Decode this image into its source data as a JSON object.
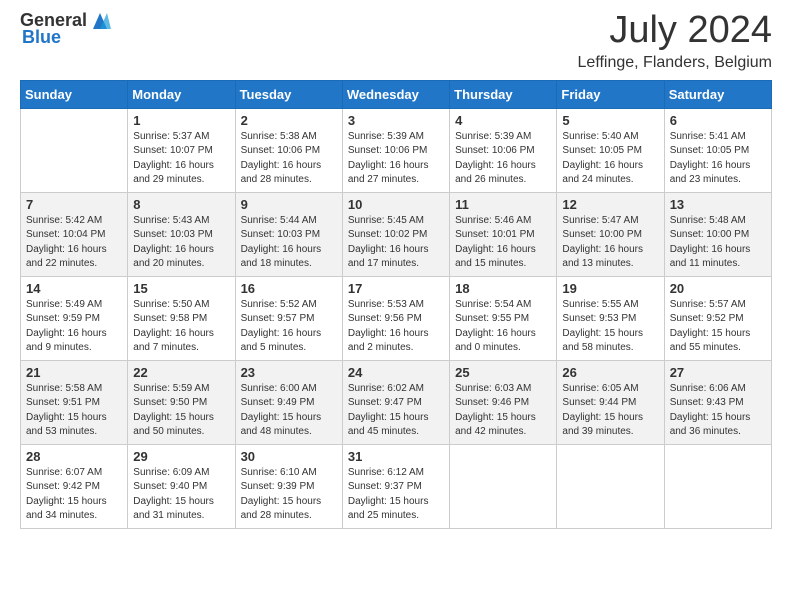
{
  "logo": {
    "general": "General",
    "blue": "Blue",
    "icon_color": "#2176c7"
  },
  "header": {
    "month": "July 2024",
    "location": "Leffinge, Flanders, Belgium"
  },
  "days_header": [
    "Sunday",
    "Monday",
    "Tuesday",
    "Wednesday",
    "Thursday",
    "Friday",
    "Saturday"
  ],
  "weeks": [
    [
      {
        "day": "",
        "info": ""
      },
      {
        "day": "1",
        "info": "Sunrise: 5:37 AM\nSunset: 10:07 PM\nDaylight: 16 hours\nand 29 minutes."
      },
      {
        "day": "2",
        "info": "Sunrise: 5:38 AM\nSunset: 10:06 PM\nDaylight: 16 hours\nand 28 minutes."
      },
      {
        "day": "3",
        "info": "Sunrise: 5:39 AM\nSunset: 10:06 PM\nDaylight: 16 hours\nand 27 minutes."
      },
      {
        "day": "4",
        "info": "Sunrise: 5:39 AM\nSunset: 10:06 PM\nDaylight: 16 hours\nand 26 minutes."
      },
      {
        "day": "5",
        "info": "Sunrise: 5:40 AM\nSunset: 10:05 PM\nDaylight: 16 hours\nand 24 minutes."
      },
      {
        "day": "6",
        "info": "Sunrise: 5:41 AM\nSunset: 10:05 PM\nDaylight: 16 hours\nand 23 minutes."
      }
    ],
    [
      {
        "day": "7",
        "info": "Sunrise: 5:42 AM\nSunset: 10:04 PM\nDaylight: 16 hours\nand 22 minutes."
      },
      {
        "day": "8",
        "info": "Sunrise: 5:43 AM\nSunset: 10:03 PM\nDaylight: 16 hours\nand 20 minutes."
      },
      {
        "day": "9",
        "info": "Sunrise: 5:44 AM\nSunset: 10:03 PM\nDaylight: 16 hours\nand 18 minutes."
      },
      {
        "day": "10",
        "info": "Sunrise: 5:45 AM\nSunset: 10:02 PM\nDaylight: 16 hours\nand 17 minutes."
      },
      {
        "day": "11",
        "info": "Sunrise: 5:46 AM\nSunset: 10:01 PM\nDaylight: 16 hours\nand 15 minutes."
      },
      {
        "day": "12",
        "info": "Sunrise: 5:47 AM\nSunset: 10:00 PM\nDaylight: 16 hours\nand 13 minutes."
      },
      {
        "day": "13",
        "info": "Sunrise: 5:48 AM\nSunset: 10:00 PM\nDaylight: 16 hours\nand 11 minutes."
      }
    ],
    [
      {
        "day": "14",
        "info": "Sunrise: 5:49 AM\nSunset: 9:59 PM\nDaylight: 16 hours\nand 9 minutes."
      },
      {
        "day": "15",
        "info": "Sunrise: 5:50 AM\nSunset: 9:58 PM\nDaylight: 16 hours\nand 7 minutes."
      },
      {
        "day": "16",
        "info": "Sunrise: 5:52 AM\nSunset: 9:57 PM\nDaylight: 16 hours\nand 5 minutes."
      },
      {
        "day": "17",
        "info": "Sunrise: 5:53 AM\nSunset: 9:56 PM\nDaylight: 16 hours\nand 2 minutes."
      },
      {
        "day": "18",
        "info": "Sunrise: 5:54 AM\nSunset: 9:55 PM\nDaylight: 16 hours\nand 0 minutes."
      },
      {
        "day": "19",
        "info": "Sunrise: 5:55 AM\nSunset: 9:53 PM\nDaylight: 15 hours\nand 58 minutes."
      },
      {
        "day": "20",
        "info": "Sunrise: 5:57 AM\nSunset: 9:52 PM\nDaylight: 15 hours\nand 55 minutes."
      }
    ],
    [
      {
        "day": "21",
        "info": "Sunrise: 5:58 AM\nSunset: 9:51 PM\nDaylight: 15 hours\nand 53 minutes."
      },
      {
        "day": "22",
        "info": "Sunrise: 5:59 AM\nSunset: 9:50 PM\nDaylight: 15 hours\nand 50 minutes."
      },
      {
        "day": "23",
        "info": "Sunrise: 6:00 AM\nSunset: 9:49 PM\nDaylight: 15 hours\nand 48 minutes."
      },
      {
        "day": "24",
        "info": "Sunrise: 6:02 AM\nSunset: 9:47 PM\nDaylight: 15 hours\nand 45 minutes."
      },
      {
        "day": "25",
        "info": "Sunrise: 6:03 AM\nSunset: 9:46 PM\nDaylight: 15 hours\nand 42 minutes."
      },
      {
        "day": "26",
        "info": "Sunrise: 6:05 AM\nSunset: 9:44 PM\nDaylight: 15 hours\nand 39 minutes."
      },
      {
        "day": "27",
        "info": "Sunrise: 6:06 AM\nSunset: 9:43 PM\nDaylight: 15 hours\nand 36 minutes."
      }
    ],
    [
      {
        "day": "28",
        "info": "Sunrise: 6:07 AM\nSunset: 9:42 PM\nDaylight: 15 hours\nand 34 minutes."
      },
      {
        "day": "29",
        "info": "Sunrise: 6:09 AM\nSunset: 9:40 PM\nDaylight: 15 hours\nand 31 minutes."
      },
      {
        "day": "30",
        "info": "Sunrise: 6:10 AM\nSunset: 9:39 PM\nDaylight: 15 hours\nand 28 minutes."
      },
      {
        "day": "31",
        "info": "Sunrise: 6:12 AM\nSunset: 9:37 PM\nDaylight: 15 hours\nand 25 minutes."
      },
      {
        "day": "",
        "info": ""
      },
      {
        "day": "",
        "info": ""
      },
      {
        "day": "",
        "info": ""
      }
    ]
  ]
}
